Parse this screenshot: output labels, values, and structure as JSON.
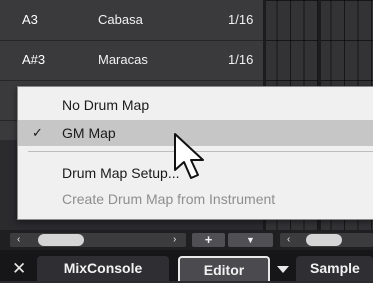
{
  "drum_list": {
    "rows": [
      {
        "pitch": "A3",
        "name": "Cabasa",
        "quantize": "1/16"
      },
      {
        "pitch": "A#3",
        "name": "Maracas",
        "quantize": "1/16"
      }
    ]
  },
  "menu": {
    "items": [
      {
        "label": "No Drum Map",
        "checked": false,
        "selected": false,
        "enabled": true
      },
      {
        "label": "GM Map",
        "checked": true,
        "selected": true,
        "enabled": true,
        "check_glyph": "✓"
      },
      {
        "label": "Drum Map Setup...",
        "checked": false,
        "selected": false,
        "enabled": true
      },
      {
        "label": "Create Drum Map from Instrument",
        "checked": false,
        "selected": false,
        "enabled": false
      }
    ]
  },
  "scrollbar": {
    "left_arrow": "‹",
    "right_arrow": "›",
    "plus_label": "+",
    "dropdown_glyph": "▼"
  },
  "tabs": {
    "close_glyph": "✕",
    "items": [
      {
        "label": "MixConsole",
        "active": false
      },
      {
        "label": "Editor",
        "active": true
      },
      {
        "label": "Sample",
        "active": false
      }
    ]
  },
  "icons": {
    "check": "check-icon",
    "cursor": "arrow-cursor-icon",
    "close": "close-icon",
    "chevron": "chevron-down-icon"
  },
  "colors": {
    "menu_background": "#f0f0f0",
    "menu_selected": "#c6c6c6",
    "disabled_text": "#8e8e8e",
    "panel_background": "#3a3a3c",
    "tab_active_border": "#e8e8e8"
  }
}
